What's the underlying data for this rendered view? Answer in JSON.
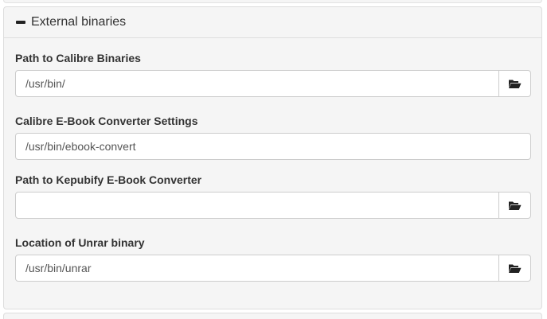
{
  "panel": {
    "title": "External binaries",
    "collapse_icon": "minus-icon"
  },
  "fields": [
    {
      "label": "Path to Calibre Binaries",
      "value": "/usr/bin/",
      "placeholder": "",
      "button_icon": "folder-open-icon"
    },
    {
      "label": "Calibre E-Book Converter Settings",
      "value": "/usr/bin/ebook-convert",
      "placeholder": ""
    },
    {
      "label": "Path to Kepubify E-Book Converter",
      "value": "",
      "placeholder": "",
      "button_icon": "folder-open-icon"
    },
    {
      "label": "Location of Unrar binary",
      "value": "/usr/bin/unrar",
      "placeholder": "",
      "button_icon": "folder-open-icon"
    }
  ]
}
